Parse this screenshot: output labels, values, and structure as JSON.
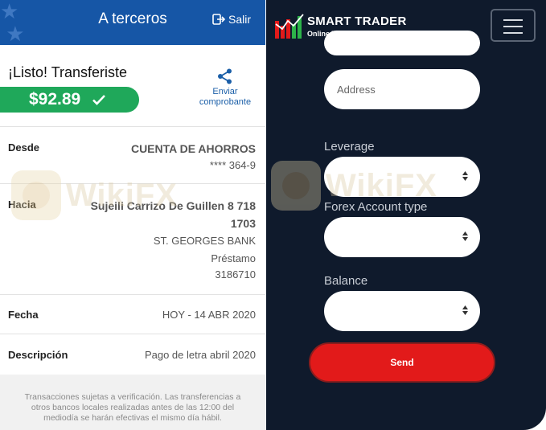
{
  "bank_screen": {
    "header": {
      "title": "A terceros",
      "logout_label": "Salir"
    },
    "status_text": "¡Listo! Transferiste",
    "amount": "$92.89",
    "share": {
      "label_line1": "Enviar",
      "label_line2": "comprobante"
    },
    "details": {
      "from": {
        "label": "Desde",
        "account_type": "CUENTA DE AHORROS",
        "account_masked": "**** 364-9"
      },
      "to": {
        "label": "Hacia",
        "name_line1": "Sujeili Carrizo De Guillen 8 718",
        "name_line2": "1703",
        "bank": "ST. GEORGES BANK",
        "product": "Préstamo",
        "product_number": "3186710"
      },
      "date": {
        "label": "Fecha",
        "value": "HOY - 14 ABR 2020"
      },
      "description": {
        "label": "Descripción",
        "value": "Pago de letra abril 2020"
      }
    },
    "footer_note": "Transacciones sujetas a verificación. Las transferencias a otros bancos locales realizadas antes de las 12:00 del mediodía se harán efectivas el mismo día hábil.",
    "colors": {
      "header": "#1656a6",
      "success": "#1fa85a",
      "link": "#1b5fa8"
    }
  },
  "trading_screen": {
    "brand": {
      "name": "SMART TRADER",
      "tagline": "Online Trading Company"
    },
    "form": {
      "address_placeholder": "Address",
      "leverage_label": "Leverage",
      "forex_account_type_label": "Forex Account type",
      "balance_label": "Balance",
      "send_label": "Send"
    },
    "colors": {
      "background": "#0f1a2c",
      "send_button": "#e21a1a"
    }
  },
  "watermark": {
    "text": "WikiFX"
  },
  "icons": [
    "logout-icon",
    "checkmark-icon",
    "share-icon",
    "smart-trader-logo-icon",
    "hamburger-menu-icon",
    "select-arrows-icon"
  ]
}
